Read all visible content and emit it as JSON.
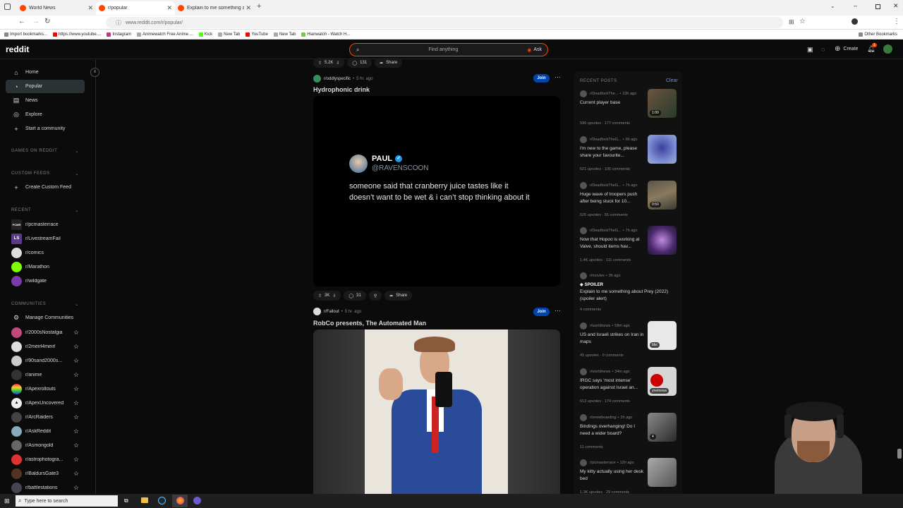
{
  "browser": {
    "tabs": [
      {
        "title": "World News"
      },
      {
        "title": "r/popular"
      },
      {
        "title": "Explain to me something about"
      }
    ],
    "url": "www.reddit.com/r/popular/",
    "bookmarks": [
      "Import bookmarks...",
      "https://www.youtube....",
      "Instagram",
      "Animewatch Free Anime ...",
      "Kick",
      "New Tab",
      "YouTube",
      "New Tab",
      "Hianwatch - Watch H..."
    ],
    "other_bookmarks": "Other Bookmarks"
  },
  "header": {
    "logo": "reddit",
    "search_placeholder": "Find anything",
    "ask_label": "Ask",
    "create_label": "Create",
    "notification_count": "1"
  },
  "sidebar": {
    "nav": [
      {
        "label": "Home",
        "icon": "home-icon"
      },
      {
        "label": "Popular",
        "icon": "popular-icon"
      },
      {
        "label": "News",
        "icon": "news-icon"
      },
      {
        "label": "Explore",
        "icon": "explore-icon"
      },
      {
        "label": "Start a community",
        "icon": "plus-icon"
      }
    ],
    "games_label": "GAMES ON REDDIT",
    "custom_feeds_label": "CUSTOM FEEDS",
    "create_feed_label": "Create Custom Feed",
    "recent_label": "RECENT",
    "recent": [
      "r/pcmasterrace",
      "r/LivestreamFail",
      "r/comics",
      "r/Marathon",
      "r/wildgate"
    ],
    "communities_label": "COMMUNITIES",
    "manage_label": "Manage Communities",
    "communities": [
      "r/2000sNostalgia",
      "r/2meirl4meirl",
      "r/90sand2000s...",
      "r/anime",
      "r/Apexrollouts",
      "r/ApexUncovered",
      "r/ArcRaiders",
      "r/AskReddit",
      "r/Asmongold",
      "r/astrophotogra...",
      "r/BaldursGate3",
      "r/battlestations"
    ]
  },
  "feed": {
    "top_actions": {
      "votes": "5.2K",
      "comments": "131",
      "share": "Share"
    },
    "post1": {
      "subreddit": "r/oddlyspecific",
      "time": "5 hr. ago",
      "join": "Join",
      "title": "Hydrophonic drink",
      "tweet_name": "PAUL",
      "tweet_handle": "@RAVENSCOON",
      "tweet_text": "someone said that cranberry juice tastes like it doesn’t want to be wet & i can’t stop thinking about it",
      "votes": "3K",
      "comments": "31",
      "share": "Share"
    },
    "post2": {
      "subreddit": "r/Fallout",
      "time": "5 hr. ago",
      "join": "Join",
      "title": "RobCo presents, The Automated Man"
    }
  },
  "recent_posts": {
    "heading": "RECENT POSTS",
    "clear": "Clear",
    "items": [
      {
        "sub": "r/DeadlockThe...",
        "time": "10h ago",
        "title": "Current player base",
        "meta": "596 upvotes · 177 comments",
        "badge": "1:00",
        "thumb": "#6b5540"
      },
      {
        "sub": "r/DeadlockTheG...",
        "time": "6h ago",
        "title": "I'm new to the game, please share your favourite...",
        "meta": "621 upvotes · 106 comments",
        "badge": "",
        "thumb": "#3a3fa0"
      },
      {
        "sub": "r/DeadlockTheG...",
        "time": "7h ago",
        "title": "Huge wave of troopers push after being stuck for 10...",
        "meta": "525 upvotes · 55 comments",
        "badge": "0:50",
        "thumb": "#5a5448"
      },
      {
        "sub": "r/DeadlockTheG...",
        "time": "7h ago",
        "title": "Now that Hopoo is working at Valve, should items hav...",
        "meta": "1.4K upvotes · 111 comments",
        "badge": "",
        "thumb": "#4a2a6a"
      },
      {
        "sub": "r/movies",
        "time": "3h ago",
        "spoiler": "SPOILER",
        "title": "Explain to me something about Prey (2022) (spoiler alert)",
        "meta": "4 comments",
        "badge": "",
        "thumb": ""
      },
      {
        "sub": "r/worldnews",
        "time": "58m ago",
        "title": "US and Israeli strikes on Iran in maps",
        "meta": "45 upvotes · 9 comments",
        "badge": "bbc",
        "thumb": "#e8e8e8"
      },
      {
        "sub": "r/worldnews",
        "time": "34m ago",
        "title": "IRGC says 'most intense' operation against Israel an...",
        "meta": "613 upvotes · 174 comments",
        "badge": "ynetnews",
        "thumb": "#d6d6d6"
      },
      {
        "sub": "r/snowboarding",
        "time": "2h ago",
        "title": "Bindings overhanging! Do I need a wider board?",
        "meta": "11 comments",
        "badge": "4",
        "thumb": "#5a5a5a"
      },
      {
        "sub": "r/pcmasterrace",
        "time": "12h ago",
        "title": "My kitty actually using her desk bed",
        "meta": "1.3K upvotes · 29 comments",
        "badge": "",
        "thumb": "#9a9a9a"
      }
    ]
  },
  "taskbar": {
    "search_placeholder": "Type here to search"
  }
}
